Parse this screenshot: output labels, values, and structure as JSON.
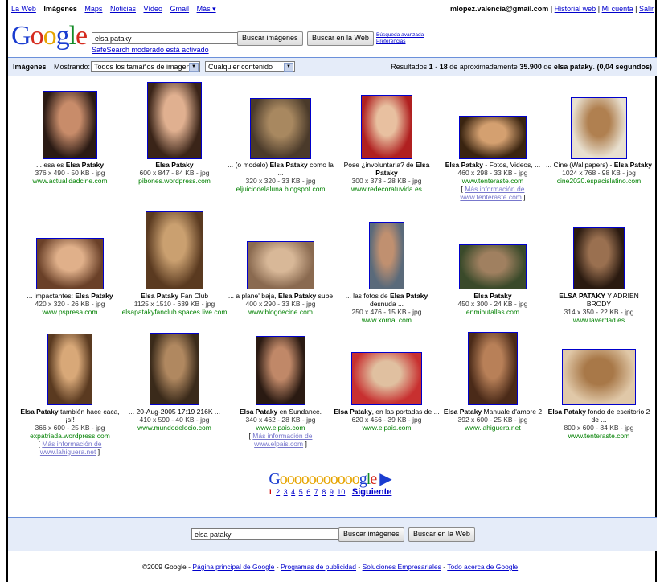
{
  "top_nav": {
    "items": [
      {
        "label": "La Web",
        "current": false
      },
      {
        "label": "Imágenes",
        "current": true
      },
      {
        "label": "Maps",
        "current": false
      },
      {
        "label": "Noticias",
        "current": false
      },
      {
        "label": "Vídeo",
        "current": false
      },
      {
        "label": "Gmail",
        "current": false
      },
      {
        "label": "Más ▾",
        "current": false
      }
    ]
  },
  "user_bar": {
    "email": "mlopez.valencia@gmail.com",
    "sep": "|",
    "history": "Historial web",
    "account": "Mi cuenta",
    "signout": "Salir"
  },
  "logo": {
    "text": "Google"
  },
  "search": {
    "query": "elsa pataky",
    "btn_images": "Buscar imágenes",
    "btn_web": "Buscar en la Web",
    "advanced": "Búsqueda avanzada",
    "preferences": "Preferencias",
    "safesearch": "SafeSearch moderado está activado"
  },
  "toolbar": {
    "section": "Imágenes",
    "showing": "Mostrando:",
    "size_filter": "Todos los tamaños de imagen",
    "content_filter": "Cualquier contenido",
    "results_prefix": "Resultados",
    "results_range_a": "1",
    "results_dash": "-",
    "results_range_b": "18",
    "results_of": "de aproximadamente",
    "results_total": "35.900",
    "results_for": "de",
    "results_query": "elsa pataky",
    "results_time": "(0,04 segundos)"
  },
  "results": [
    {
      "t1": "... esa es ",
      "t2": "Elsa Pataky",
      "t3": "",
      "meta": "376 x 490 - 50 KB - jpg",
      "site": "www.actualidadcine.com",
      "more": ""
    },
    {
      "t1": "",
      "t2": "Elsa Pataky",
      "t3": "",
      "meta": "600 x 847 - 84 KB - jpg",
      "site": "pibones.wordpress.com",
      "more": ""
    },
    {
      "t1": "... (o modelo) ",
      "t2": "Elsa Pataky",
      "t3": " como la ...",
      "meta": "320 x 320 - 33 KB - jpg",
      "site": "eljuiciodelaluna.blogspot.com",
      "more": ""
    },
    {
      "t1": "Pose ¿involuntaria? de ",
      "t2": "Elsa Pataky",
      "t3": "",
      "meta": "300 x 373 - 28 KB - jpg",
      "site": "www.redecoratuvida.es",
      "more": ""
    },
    {
      "t1": "",
      "t2": "Elsa Pataky",
      "t3": " - Fotos, Videos, ...",
      "meta": "460 x 298 - 33 KB - jpg",
      "site": "www.tenteraste.com",
      "more": "Más información de www.tenteraste.com"
    },
    {
      "t1": "... Cine (Wallpapers) - ",
      "t2": "Elsa Pataky",
      "t3": "",
      "meta": "1024 x 768 - 98 KB - jpg",
      "site": "cine2020.espacislatino.com",
      "more": ""
    },
    {
      "t1": "... impactantes: ",
      "t2": "Elsa Pataky",
      "t3": "",
      "meta": "420 x 320 - 26 KB - jpg",
      "site": "www.pspresa.com",
      "more": ""
    },
    {
      "t1": "",
      "t2": "Elsa Pataky",
      "t3": " Fan Club",
      "meta": "1125 x 1510 - 639 KB - jpg",
      "site": "elsapatakyfanclub.spaces.live.com",
      "more": ""
    },
    {
      "t1": "... a plane' baja, ",
      "t2": "Elsa Pataky",
      "t3": " sube",
      "meta": "400 x 290 - 33 KB - jpg",
      "site": "www.blogdecine.com",
      "more": ""
    },
    {
      "t1": "... las fotos de ",
      "t2": "Elsa Pataky",
      "t3": " desnuda ...",
      "meta": "250 x 476 - 15 KB - jpg",
      "site": "www.xornal.com",
      "more": ""
    },
    {
      "t1": "",
      "t2": "Elsa Pataky",
      "t3": "",
      "meta": "450 x 300 - 24 KB - jpg",
      "site": "enmibutallas.com",
      "more": ""
    },
    {
      "t1": "",
      "t2": "ELSA PATAKY",
      "t3": " Y ADRIEN BRODY",
      "meta": "314 x 350 - 22 KB - jpg",
      "site": "www.laverdad.es",
      "more": ""
    },
    {
      "t1": "",
      "t2": "Elsa Pataky",
      "t3": " también hace caca, ¡sí!",
      "meta": "366 x 600 - 25 KB - jpg",
      "site": "expatriada.wordpress.com",
      "more": "Más información de www.lahiguera.net"
    },
    {
      "t1": "... 20-Aug-2005 17:19 216K ...",
      "t2": "",
      "t3": "",
      "meta": "410 x 590 - 40 KB - jpg",
      "site": "www.mundodelocio.com",
      "more": ""
    },
    {
      "t1": "",
      "t2": "Elsa Pataky",
      "t3": " en Sundance.",
      "meta": "340 x 462 - 28 KB - jpg",
      "site": "www.elpais.com",
      "more": "Más información de www.elpais.com"
    },
    {
      "t1": "",
      "t2": "Elsa Pataky",
      "t3": ", en las portadas de ...",
      "meta": "620 x 456 - 39 KB - jpg",
      "site": "www.elpais.com",
      "more": ""
    },
    {
      "t1": "",
      "t2": "Elsa Pataky",
      "t3": " Manuale d'amore 2",
      "meta": "392 x 600 - 25 KB - jpg",
      "site": "www.lahiguera.net",
      "more": ""
    },
    {
      "t1": "",
      "t2": "Elsa Pataky",
      "t3": " fondo de escritorio 2 de ...",
      "meta": "800 x 600 - 84 KB - jpg",
      "site": "www.tenteraste.com",
      "more": ""
    }
  ],
  "pager": {
    "pages": [
      "1",
      "2",
      "3",
      "4",
      "5",
      "6",
      "7",
      "8",
      "9",
      "10"
    ],
    "next": "Siguiente"
  },
  "footer": {
    "copyright": "©2009 Google",
    "links": [
      "Página principal de Google",
      "Programas de publicidad",
      "Soluciones Empresariales",
      "Todo acerca de Google"
    ]
  },
  "colors": {
    "link": "#0000cc",
    "url_green": "#008000",
    "bar_bg": "#e5ecf9",
    "bar_border": "#6b90da"
  }
}
